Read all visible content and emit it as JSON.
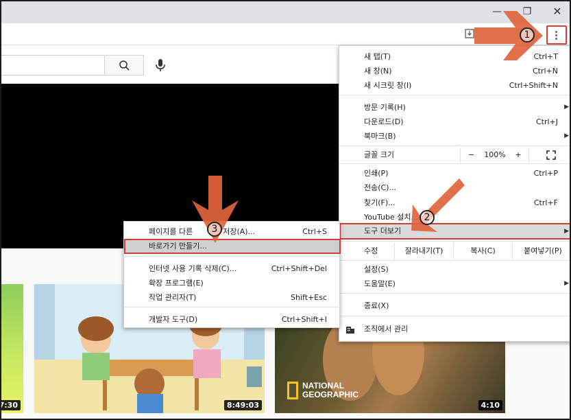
{
  "window": {
    "minimize_glyph": "—",
    "restore_glyph": "❐",
    "close_glyph": "✕"
  },
  "colors": {
    "accent_red": "#d23b3b",
    "arrow_orange": "#e0643c",
    "highlight_gray": "#dadada"
  },
  "menu": {
    "items": [
      {
        "label": "새 탭(T)",
        "shortcut": "Ctrl+T"
      },
      {
        "label": "새 창(N)",
        "shortcut": "Ctrl+N"
      },
      {
        "label": "새 시크릿 창(I)",
        "shortcut": "Ctrl+Shift+N"
      },
      {
        "label": "방문 기록(H)",
        "arrow": "▶"
      },
      {
        "label": "다운로드(D)",
        "shortcut": "Ctrl+J"
      },
      {
        "label": "북마크(B)",
        "arrow": "▶"
      },
      {
        "label": "인쇄(P)",
        "shortcut": "Ctrl+P"
      },
      {
        "label": "전송(C)..."
      },
      {
        "label": "찾기(F)...",
        "shortcut": "Ctrl+F"
      },
      {
        "label": "YouTube 설치..."
      },
      {
        "label": "도구 더보기",
        "arrow": "▶"
      },
      {
        "label": "설정(S)"
      },
      {
        "label": "도움말(E)",
        "arrow": "▶"
      },
      {
        "label": "종료(X)"
      },
      {
        "label": "조직에서 관리"
      }
    ],
    "zoom": {
      "label": "글꼴 크기",
      "minus": "−",
      "value": "100%",
      "plus": "+",
      "fullscreen_icon": "fullscreen-icon"
    },
    "edit": {
      "label": "수정",
      "cut": "잘라내기(T)",
      "copy": "복사(C)",
      "paste": "붙여넣기(P)"
    }
  },
  "submenu": {
    "items": [
      {
        "label": "페이지를 다른",
        "label_tail": "저장(A)...",
        "shortcut": "Ctrl+S"
      },
      {
        "label": "바로가기 만들기..."
      },
      {
        "label": "인터넷 사용 기록 삭제(C)...",
        "shortcut": "Ctrl+Shift+Del"
      },
      {
        "label": "확장 프로그램(E)"
      },
      {
        "label": "작업 관리자(T)",
        "shortcut": "Shift+Esc"
      },
      {
        "label": "개발자 도구(D)",
        "shortcut": "Ctrl+Shift+I"
      }
    ]
  },
  "annotations": {
    "step1": "1",
    "step2": "2",
    "step3": "3"
  },
  "thumbnails": [
    {
      "duration": "7:30"
    },
    {
      "duration": "8:49:03"
    },
    {
      "duration": "4:10",
      "brand": "NATIONAL GEOGRAPHIC",
      "brand_line1": "NATIONAL",
      "brand_line2": "GEOGRAPHIC"
    }
  ]
}
